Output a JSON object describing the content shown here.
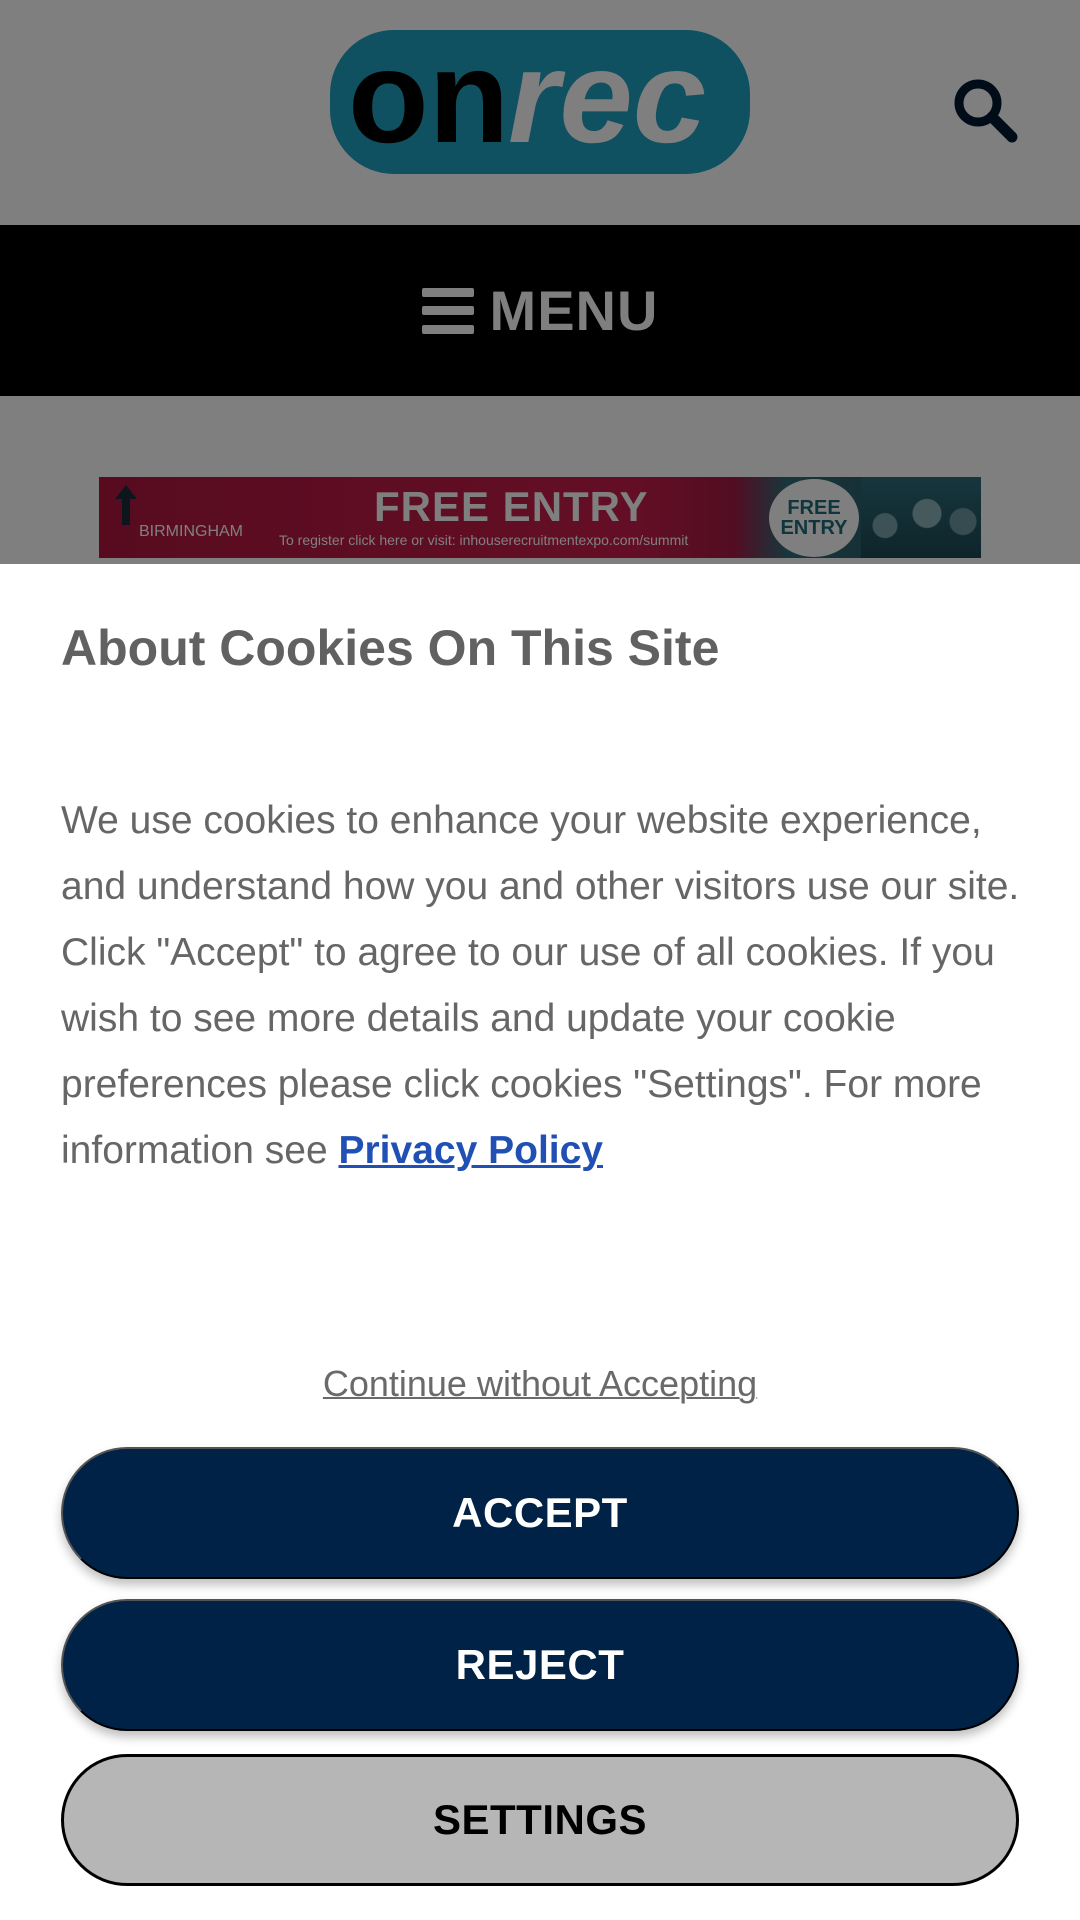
{
  "header": {
    "logo_text_dark": "on",
    "logo_text_light": "rec",
    "search_icon": "search-icon"
  },
  "nav": {
    "menu_icon": "hamburger-icon",
    "menu_label": "MENU"
  },
  "ad": {
    "city": "BIRMINGHAM",
    "headline": "FREE ENTRY",
    "subtext": "To register click here or visit: inhouserecruitmentexpo.com/summit",
    "badge_line1": "FREE",
    "badge_line2": "ENTRY"
  },
  "cookie": {
    "title": "About Cookies On This Site",
    "body": "We use cookies to enhance your website experience, and understand how you and other visitors use our site. Click \"Accept\" to agree to our use of all cookies. If you wish to see more details and update your cookie preferences please click cookies \"Settings\". For more information see ",
    "privacy_link": "Privacy Policy",
    "continue_label": "Continue without Accepting",
    "accept_label": "ACCEPT",
    "reject_label": "REJECT",
    "settings_label": "SETTINGS"
  },
  "colors": {
    "logo_teal": "#1ea0c3",
    "button_navy": "#002247",
    "link_blue": "#2150b4",
    "settings_gray": "#b6b6b6"
  }
}
